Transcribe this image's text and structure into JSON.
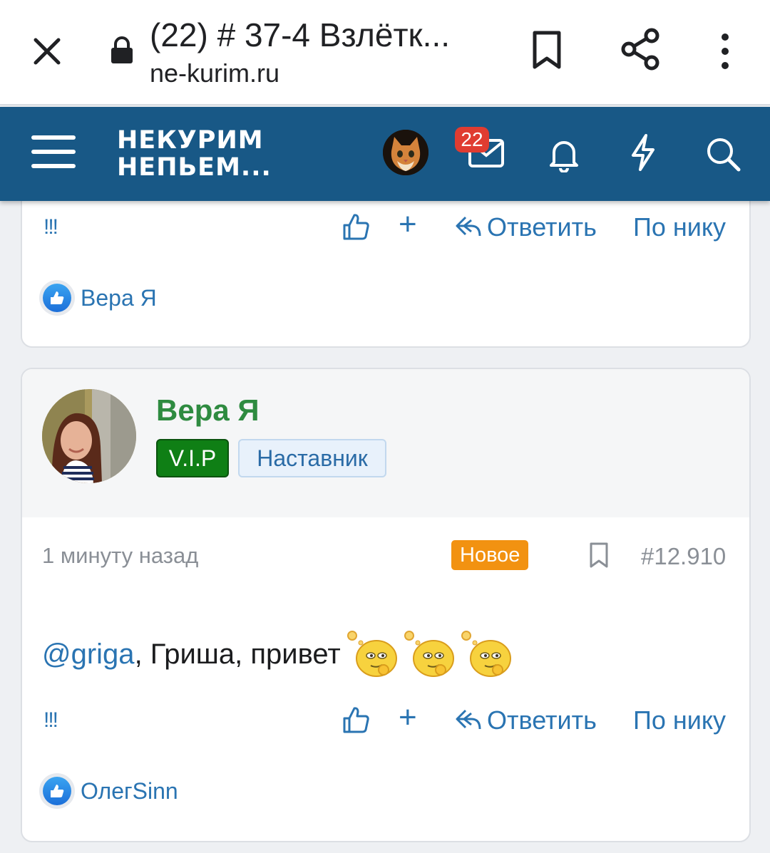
{
  "browser": {
    "tab_title": "(22) # 37-4 Взлётк...",
    "url": "ne-kurim.ru"
  },
  "header": {
    "logo_line1": "НЕКУРИМ",
    "logo_line2": "НЕПЬЕМ...",
    "inbox_count": "22",
    "accent_color": "#185886"
  },
  "post_prev": {
    "actions": {
      "exclaim": "!!!",
      "plus": "+",
      "reply": "Ответить",
      "by_nick": "По нику"
    },
    "reaction_user": "Вера Я"
  },
  "post": {
    "author": "Вера Я",
    "badges": [
      "V.I.P",
      "Наставник"
    ],
    "time": "1 минуту назад",
    "new_label": "Новое",
    "number": "#12.910",
    "mention": "@griga",
    "text": ", Гриша, привет",
    "actions": {
      "exclaim": "!!!",
      "plus": "+",
      "reply": "Ответить",
      "by_nick": "По нику"
    },
    "reaction_user": "ОлегSinn"
  }
}
